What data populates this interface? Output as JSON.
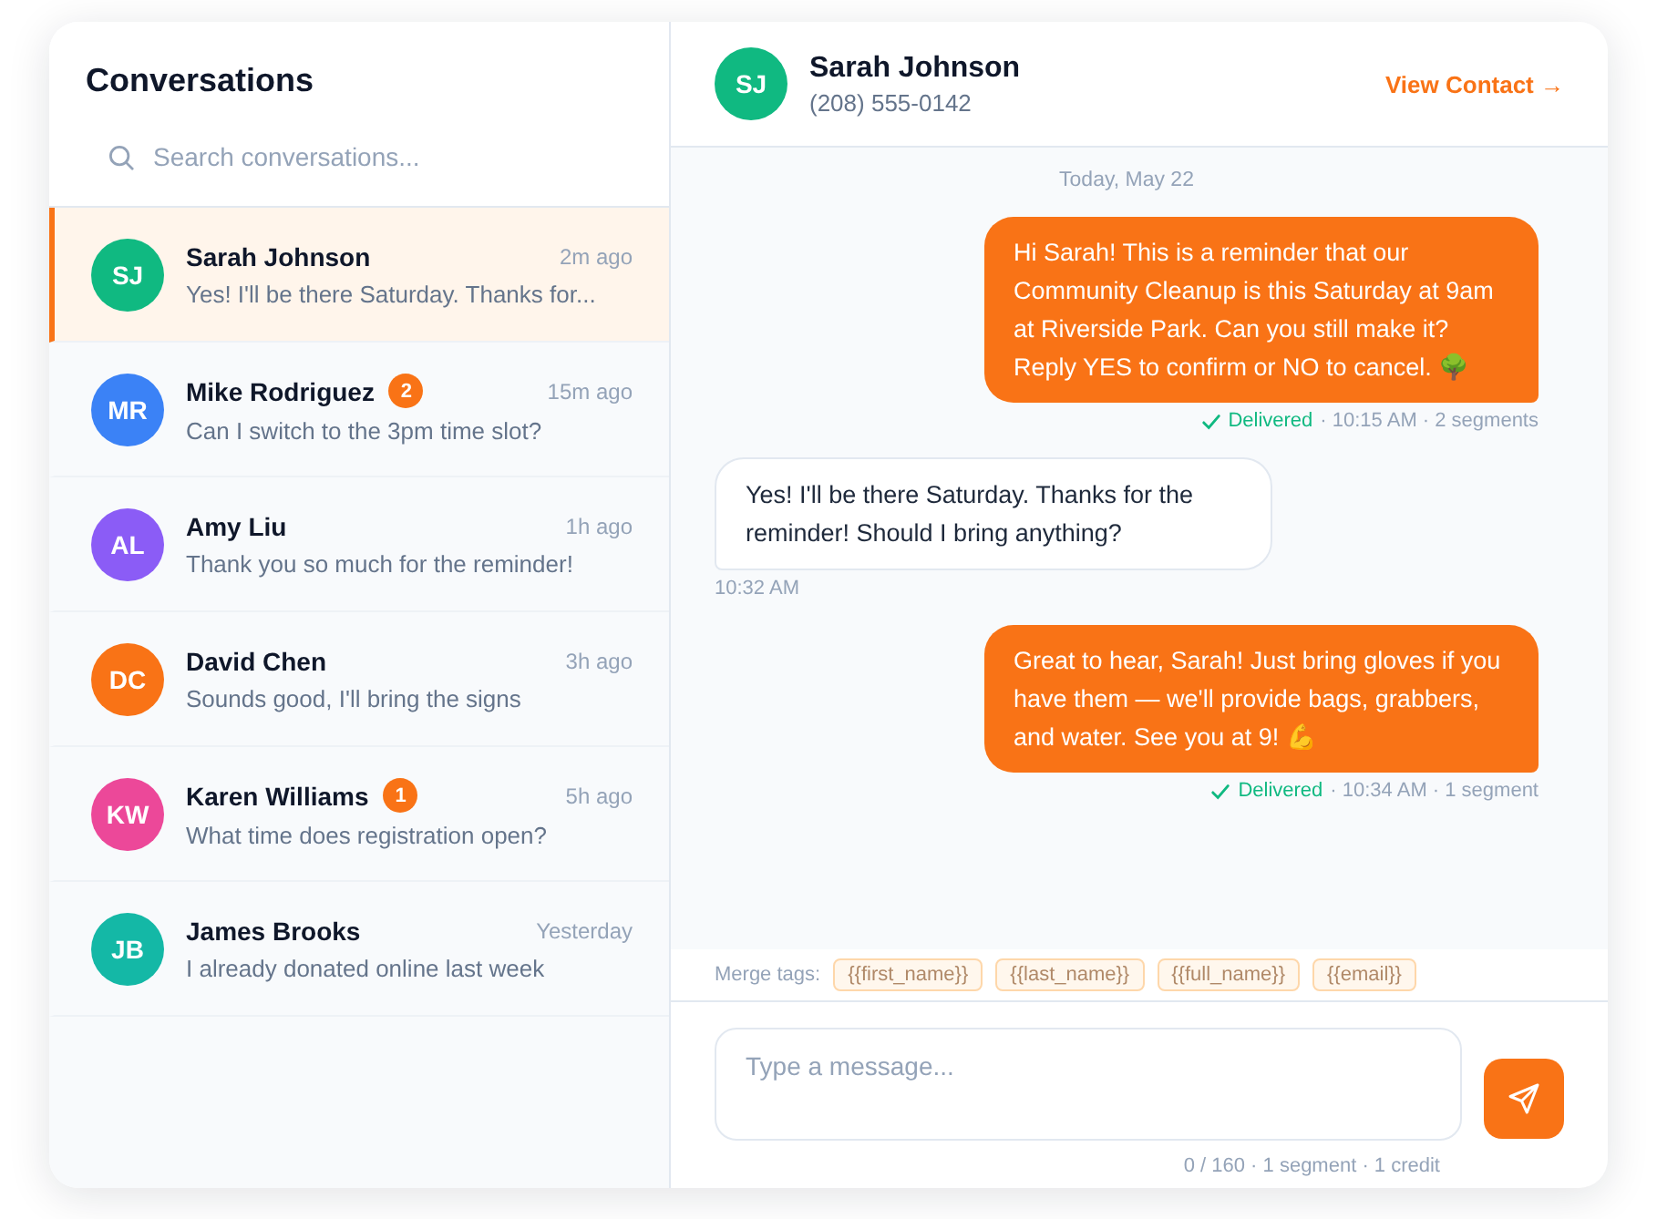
{
  "sidebar": {
    "title": "Conversations",
    "search": {
      "placeholder": "Search conversations..."
    },
    "conversations": [
      {
        "initials": "SJ",
        "color": "#10b981",
        "name": "Sarah Johnson",
        "time": "2m ago",
        "preview": "Yes! I'll be there Saturday. Thanks for...",
        "selected": true
      },
      {
        "initials": "MR",
        "color": "#3b82f6",
        "name": "Mike Rodriguez",
        "unread": "2",
        "time": "15m ago",
        "preview": "Can I switch to the 3pm time slot?",
        "selected": false
      },
      {
        "initials": "AL",
        "color": "#8b5cf6",
        "name": "Amy Liu",
        "time": "1h ago",
        "preview": "Thank you so much for the reminder!",
        "selected": false
      },
      {
        "initials": "DC",
        "color": "#f97316",
        "name": "David Chen",
        "time": "3h ago",
        "preview": "Sounds good, I'll bring the signs",
        "selected": false
      },
      {
        "initials": "KW",
        "color": "#ec4899",
        "name": "Karen Williams",
        "unread": "1",
        "time": "5h ago",
        "preview": "What time does registration open?",
        "selected": false
      },
      {
        "initials": "JB",
        "color": "#14b8a6",
        "name": "James Brooks",
        "time": "Yesterday",
        "preview": "I already donated online last week",
        "selected": false
      }
    ]
  },
  "chat": {
    "contact": {
      "initials": "SJ",
      "color": "#10b981",
      "name": "Sarah Johnson",
      "phone": "(208) 555-0142"
    },
    "view_contact": "View Contact →",
    "date": "Today, May 22",
    "messages": [
      {
        "kind": "outgoing",
        "text": "Hi Sarah! This is a reminder that our Community Cleanup is this Saturday at 9am at Riverside Park. Can you still make it? Reply YES to confirm or NO to cancel. 🌳",
        "status": "Delivered",
        "meta": "· 10:15 AM · 2 segments"
      },
      {
        "kind": "incoming",
        "text": "Yes! I'll be there Saturday. Thanks for the reminder! Should I bring anything?",
        "meta": "10:32 AM"
      },
      {
        "kind": "outgoing",
        "text": "Great to hear, Sarah! Just bring gloves if you have them — we'll provide bags, grabbers, and water. See you at 9! 💪",
        "status": "Delivered",
        "meta": "· 10:34 AM · 1 segment"
      }
    ],
    "merge_tags": {
      "label": "Merge tags:",
      "tags": [
        "{{first_name}}",
        "{{last_name}}",
        "{{full_name}}",
        "{{email}}"
      ]
    },
    "composer": {
      "placeholder": "Type a message...",
      "counter": "0 / 160 · 1 segment · 1 credit"
    }
  }
}
